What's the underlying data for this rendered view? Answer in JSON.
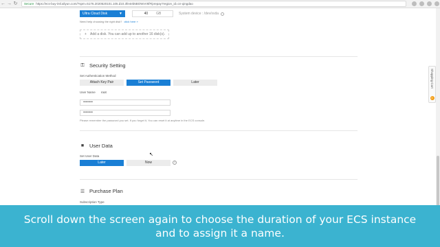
{
  "browser": {
    "secure_label": "Secure",
    "url": "https://ecs-buy-intl.aliyun.com/?spm=5176.2020520101.105.d10.3fe4eb5BOWvV6f#/prepay?region_id=cn-qingdao"
  },
  "storage": {
    "disk_type": "Ultra Cloud Disk",
    "disk_size": "40",
    "disk_unit": "GB",
    "disk_iops": "System device : /dev/xvda",
    "help_text": "Need help choosing the right disk?",
    "help_link": "click here »",
    "add_disk": "Add a disk. You can add up to another 16 disk(s)."
  },
  "security": {
    "title": "Security Setting",
    "auth_label": "Set Authentication Method",
    "options": [
      "Attach Key Pair",
      "Set Password",
      "Later"
    ],
    "username_label": "User Name",
    "username_value": "root",
    "password_value": "••••••••",
    "confirm_value": "••••••••",
    "note": "Please remember the password you set. If you forget it, You can reset it at anytime in the ECS console."
  },
  "userdata": {
    "title": "User Data",
    "label": "Set User Data",
    "options": [
      "Later",
      "Now"
    ]
  },
  "purchase": {
    "title": "Purchase Plan",
    "subscription_label": "Subscription Type"
  },
  "side": {
    "cart_label": "Shopping Cart",
    "cart_count": "0"
  },
  "caption": {
    "line1": "Scroll down the screen again to choose the duration of your ECS instance",
    "line2": "and to assign it a name."
  }
}
